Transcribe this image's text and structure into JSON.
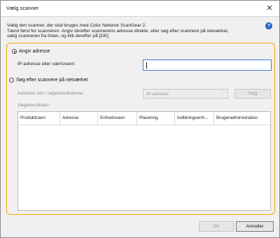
{
  "window": {
    "title": "Vælg scanner",
    "close_glyph": "✕"
  },
  "description": {
    "line1": "Vælg den scanner, der skal bruges med Color Network ScanGear 2.",
    "line2": "Tænd først for scanneren. Angiv derefter scannerens adresse direkte, eller søg efter scannere på netværket,",
    "line3": "vælg scanneren fra listen, og klik derefter på [OK]."
  },
  "help": {
    "glyph": "?"
  },
  "options": {
    "specify_address": {
      "label": "Angiv adresse",
      "selected": true,
      "field_label": "IP-adresse eller værtsnavn:",
      "field_value": ""
    },
    "search_network": {
      "label": "Søg efter scannere på netværket",
      "selected": false,
      "address_label": "Adresse vist i søgeresultaterne:",
      "address_type_selected": "IP-adresse",
      "search_button": "Søg",
      "results_label": "Søgeresultater:"
    }
  },
  "table": {
    "columns": [
      "Produktnavn",
      "Adresse",
      "Enhedsnavn",
      "Placering",
      "Indføringsenh...",
      "Brugeradministration"
    ]
  },
  "footer": {
    "ok": "OK",
    "cancel": "Annuller"
  },
  "colors": {
    "highlight_frame": "#f0a800",
    "input_focus": "#3b7fd4",
    "help": "#1f5fbf"
  }
}
